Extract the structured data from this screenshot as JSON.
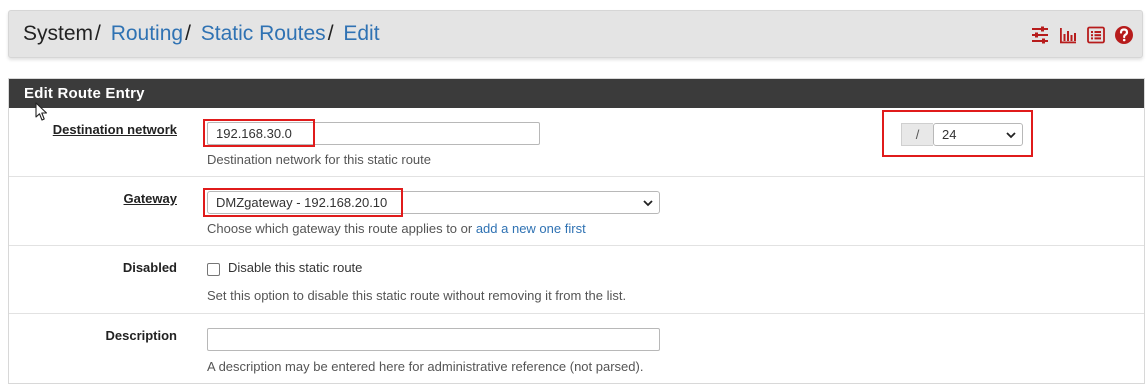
{
  "breadcrumb": {
    "root": "System",
    "separator": "/",
    "items": [
      "Routing",
      "Static Routes",
      "Edit"
    ]
  },
  "header_icons": [
    "sliders-icon",
    "bar-chart-icon",
    "list-icon",
    "help-icon"
  ],
  "colors": {
    "accent": "#2f72b3",
    "icon_red": "#b71c1c",
    "heading_bg": "#3b3b3b",
    "highlight": "#e01b1b"
  },
  "panel": {
    "title": "Edit Route Entry",
    "fields": {
      "destination": {
        "label": "Destination network",
        "value": "192.168.30.0",
        "help": "Destination network for this static route",
        "mask_separator": "/",
        "mask_value": "24"
      },
      "gateway": {
        "label": "Gateway",
        "value": "DMZgateway - 192.168.20.10",
        "help_prefix": "Choose which gateway this route applies to or ",
        "help_link": "add a new one first"
      },
      "disabled": {
        "label": "Disabled",
        "checkbox_label": "Disable this static route",
        "checked": false,
        "help": "Set this option to disable this static route without removing it from the list."
      },
      "description": {
        "label": "Description",
        "value": "",
        "help": "A description may be entered here for administrative reference (not parsed)."
      }
    }
  }
}
